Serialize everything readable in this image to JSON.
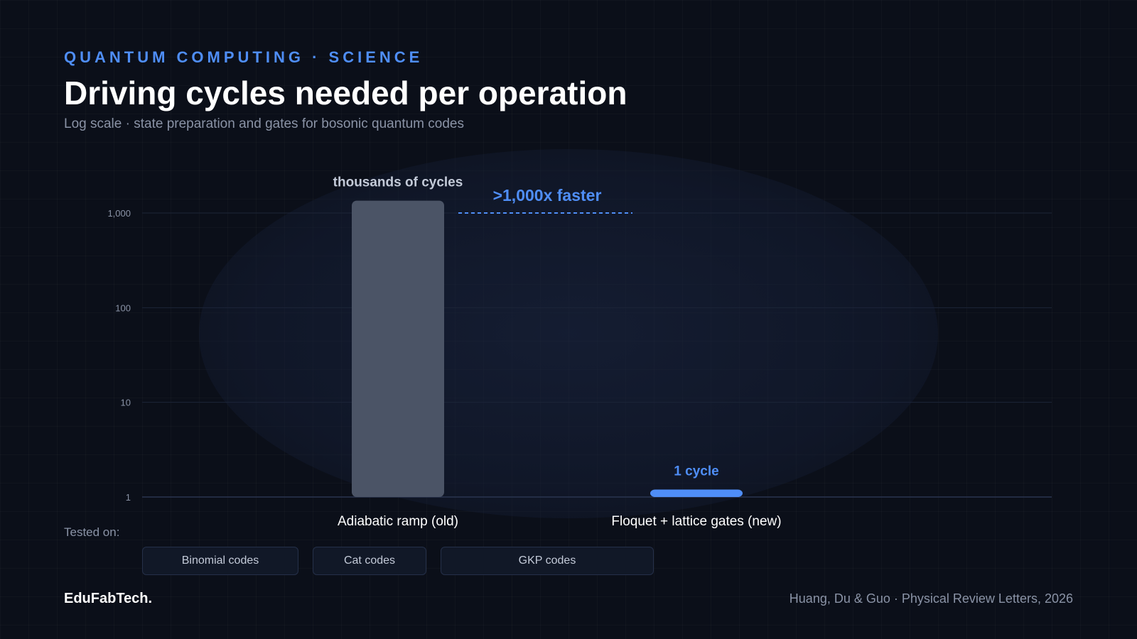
{
  "header": {
    "eyebrow": "QUANTUM COMPUTING · SCIENCE",
    "title": "Driving cycles needed per operation",
    "subtitle": "Log scale · state preparation and gates for bosonic quantum codes"
  },
  "chart_data": {
    "type": "bar",
    "scale": "log",
    "ylim": [
      1,
      1000
    ],
    "yticks": [
      1,
      10,
      100,
      1000
    ],
    "ytick_labels": [
      "1",
      "10",
      "100",
      "1,000"
    ],
    "categories": [
      "Adiabatic ramp (old)",
      "Floquet + lattice gates (new)"
    ],
    "values": [
      1350,
      1.2
    ],
    "value_labels": [
      "thousands of cycles",
      "1 cycle"
    ],
    "bar_colors": [
      "#4b5466",
      "#4f8ef7"
    ],
    "annotation": ">1,000x faster",
    "grid": true
  },
  "tested": {
    "label": "Tested on:",
    "chips": [
      "Binomial codes",
      "Cat codes",
      "GKP codes"
    ]
  },
  "footer": {
    "brand": "EduFabTech.",
    "source": "Huang, Du & Guo · Physical Review Letters, 2026"
  },
  "colors": {
    "accent": "#4f8ef7",
    "background": "#0b0f19",
    "old_bar": "#4b5466"
  }
}
